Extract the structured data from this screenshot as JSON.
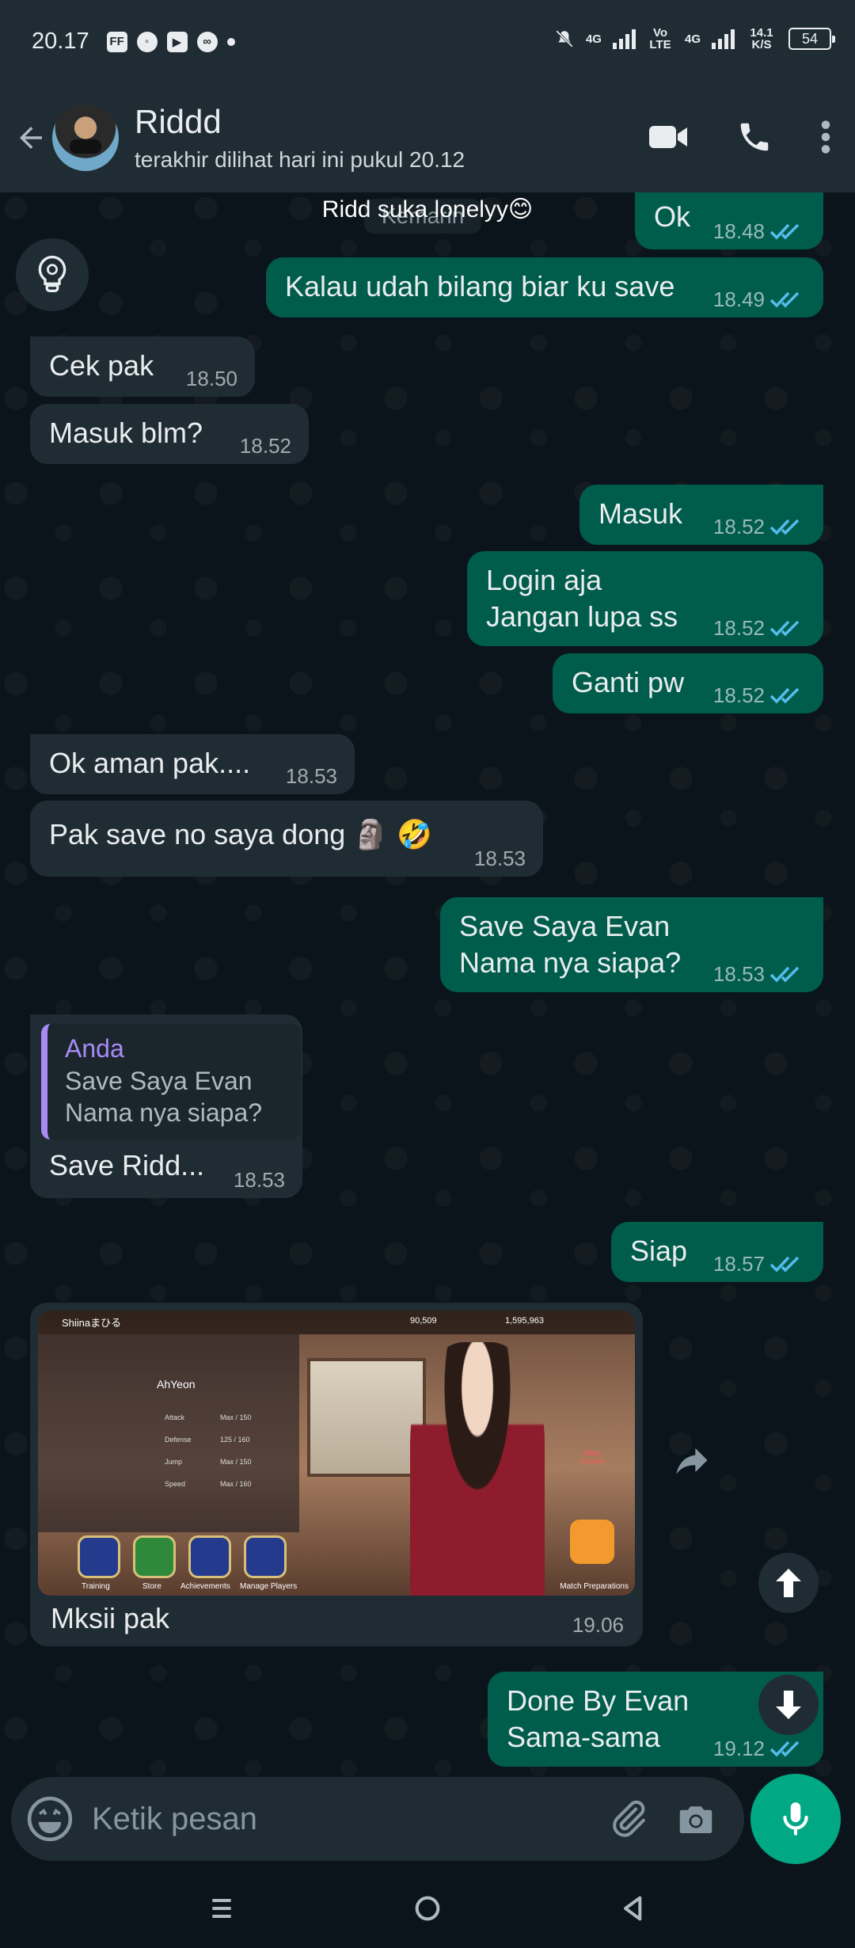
{
  "status_bar": {
    "time": "20.17",
    "icons": [
      "ff-icon",
      "messenger-icon",
      "youtube-icon",
      "infinity-icon",
      "dot"
    ],
    "net1": "4G",
    "net2": "Vo LTE",
    "net3": "4G",
    "speed": "14.1 K/S",
    "battery": "54"
  },
  "header": {
    "name": "Riddd",
    "last_seen": "terakhir dilihat hari ini pukul 20.12"
  },
  "chat": {
    "date_chip": "Kemarin",
    "date_overlay": "Ridd suka lonelyy😊",
    "messages": [
      {
        "dir": "out",
        "text": "Ok",
        "time": "18.48"
      },
      {
        "dir": "out",
        "text": "Kalau udah bilang biar ku save",
        "time": "18.49"
      },
      {
        "dir": "in",
        "text": "Cek pak",
        "time": "18.50"
      },
      {
        "dir": "in",
        "text": "Masuk blm?",
        "time": "18.52"
      },
      {
        "dir": "out",
        "text": "Masuk",
        "time": "18.52"
      },
      {
        "dir": "out",
        "line1": "Login aja",
        "line2": "Jangan lupa ss",
        "time": "18.52"
      },
      {
        "dir": "out",
        "text": "Ganti pw",
        "time": "18.52"
      },
      {
        "dir": "in",
        "text": "Ok aman pak....",
        "time": "18.53"
      },
      {
        "dir": "in",
        "text": "Pak save no saya dong 🗿 🤣",
        "time": "18.53"
      },
      {
        "dir": "out",
        "line1": "Save Saya Evan",
        "line2": "Nama nya siapa?",
        "time": "18.53"
      },
      {
        "dir": "in",
        "quote_name": "Anda",
        "quote_line1": "Save Saya Evan",
        "quote_line2": "Nama nya siapa?",
        "text": "Save Ridd...",
        "time": "18.53"
      },
      {
        "dir": "out",
        "text": "Siap",
        "time": "18.57"
      },
      {
        "dir": "in",
        "image": "game-screenshot",
        "text": "Mksii pak",
        "time": "19.06"
      },
      {
        "dir": "out",
        "line1": "Done By Evan",
        "line2": "Sama-sama",
        "time": "19.12"
      }
    ]
  },
  "game": {
    "player": "Shiinaまひる",
    "currency1": "90,509",
    "currency2": "1,595,963",
    "character": "AhYeon",
    "stats": [
      "Attack",
      "Defense",
      "Jump",
      "Speed"
    ],
    "stat_values": [
      "Max / 150",
      "125 / 160",
      "Max / 150",
      "Max / 160"
    ],
    "buttons": [
      "Training",
      "Store",
      "Achievements",
      "Manage Players",
      "Match Preparations"
    ],
    "side_label": "Effect Coupon"
  },
  "composer": {
    "placeholder": "Ketik pesan"
  },
  "colors": {
    "header_bg": "#1f2c34",
    "chat_bg": "#0b141a",
    "bubble_in": "#202c33",
    "bubble_out": "#005c4b",
    "accent": "#00a884",
    "ticks": "#53bdeb"
  }
}
